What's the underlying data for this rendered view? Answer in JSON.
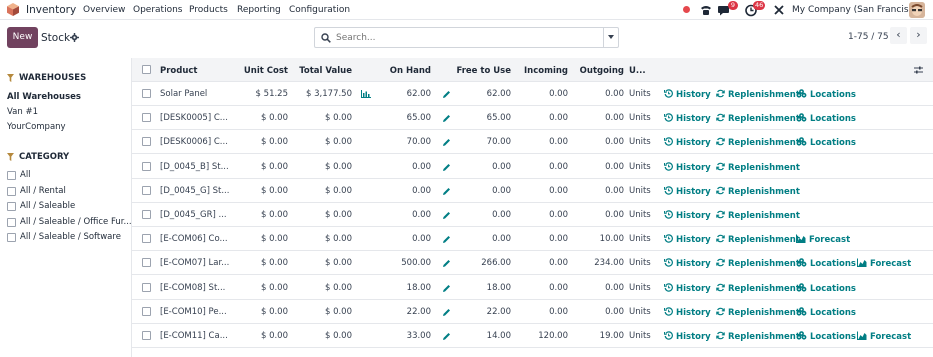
{
  "nav": {
    "app_name": "Inventory",
    "menu": [
      "Overview",
      "Operations",
      "Products",
      "Reporting",
      "Configuration"
    ],
    "activity_badge": "9",
    "clock_badge": "46",
    "company": "My Company (San Francisco)"
  },
  "control": {
    "new_label": "New",
    "breadcrumb": "Stock",
    "search_placeholder": "Search...",
    "pager": "1-75 / 75"
  },
  "sidebar": {
    "warehouses_title": "WAREHOUSES",
    "warehouses": [
      "All Warehouses",
      "Van #1",
      "YourCompany"
    ],
    "category_title": "CATEGORY",
    "categories": [
      "All",
      "All / Rental",
      "All / Saleable",
      "All / Saleable / Office Fur...",
      "All / Saleable / Software"
    ]
  },
  "table": {
    "headers": {
      "product": "Product",
      "unit_cost": "Unit Cost",
      "total_value": "Total Value",
      "on_hand": "On Hand",
      "free_to_use": "Free to Use",
      "incoming": "Incoming",
      "outgoing": "Outgoing",
      "uom": "U..."
    },
    "actions": {
      "history": "History",
      "replenishment": "Replenishment",
      "locations": "Locations",
      "forecast": "Forecast"
    },
    "rows": [
      {
        "product": "Solar Panel",
        "unit_cost": "$ 51.25",
        "total_value": "$ 3,177.50",
        "on_hand": "62.00",
        "free": "62.00",
        "incoming": "0.00",
        "outgoing": "0.00",
        "uom": "Units",
        "locations": true,
        "forecast": false,
        "forecast_short": false
      },
      {
        "product": "[DESK0005] C...",
        "unit_cost": "$ 0.00",
        "total_value": "$ 0.00",
        "on_hand": "65.00",
        "free": "65.00",
        "incoming": "0.00",
        "outgoing": "0.00",
        "uom": "Units",
        "locations": true,
        "forecast": false,
        "forecast_short": false
      },
      {
        "product": "[DESK0006] C...",
        "unit_cost": "$ 0.00",
        "total_value": "$ 0.00",
        "on_hand": "70.00",
        "free": "70.00",
        "incoming": "0.00",
        "outgoing": "0.00",
        "uom": "Units",
        "locations": true,
        "forecast": false,
        "forecast_short": false
      },
      {
        "product": "[D_0045_B] St...",
        "unit_cost": "$ 0.00",
        "total_value": "$ 0.00",
        "on_hand": "0.00",
        "free": "0.00",
        "incoming": "0.00",
        "outgoing": "0.00",
        "uom": "Units",
        "locations": false,
        "forecast": false,
        "forecast_short": false
      },
      {
        "product": "[D_0045_G] St...",
        "unit_cost": "$ 0.00",
        "total_value": "$ 0.00",
        "on_hand": "0.00",
        "free": "0.00",
        "incoming": "0.00",
        "outgoing": "0.00",
        "uom": "Units",
        "locations": false,
        "forecast": false,
        "forecast_short": false
      },
      {
        "product": "[D_0045_GR] ...",
        "unit_cost": "$ 0.00",
        "total_value": "$ 0.00",
        "on_hand": "0.00",
        "free": "0.00",
        "incoming": "0.00",
        "outgoing": "0.00",
        "uom": "Units",
        "locations": false,
        "forecast": false,
        "forecast_short": false
      },
      {
        "product": "[E-COM06] Co...",
        "unit_cost": "$ 0.00",
        "total_value": "$ 0.00",
        "on_hand": "0.00",
        "free": "0.00",
        "incoming": "0.00",
        "outgoing": "10.00",
        "uom": "Units",
        "locations": false,
        "forecast": false,
        "forecast_short": true
      },
      {
        "product": "[E-COM07] Lar...",
        "unit_cost": "$ 0.00",
        "total_value": "$ 0.00",
        "on_hand": "500.00",
        "free": "266.00",
        "incoming": "0.00",
        "outgoing": "234.00",
        "uom": "Units",
        "locations": true,
        "forecast": true,
        "forecast_short": false
      },
      {
        "product": "[E-COM08] St...",
        "unit_cost": "$ 0.00",
        "total_value": "$ 0.00",
        "on_hand": "18.00",
        "free": "18.00",
        "incoming": "0.00",
        "outgoing": "0.00",
        "uom": "Units",
        "locations": true,
        "forecast": false,
        "forecast_short": false
      },
      {
        "product": "[E-COM10] Pe...",
        "unit_cost": "$ 0.00",
        "total_value": "$ 0.00",
        "on_hand": "22.00",
        "free": "22.00",
        "incoming": "0.00",
        "outgoing": "0.00",
        "uom": "Units",
        "locations": true,
        "forecast": false,
        "forecast_short": false
      },
      {
        "product": "[E-COM11] Ca...",
        "unit_cost": "$ 0.00",
        "total_value": "$ 0.00",
        "on_hand": "33.00",
        "free": "14.00",
        "incoming": "120.00",
        "outgoing": "19.00",
        "uom": "Units",
        "locations": true,
        "forecast": true,
        "forecast_short": false
      }
    ]
  },
  "colors": {
    "brand": "#71425f",
    "action": "#017e84",
    "badge": "#dc3545"
  },
  "icons": [
    "inventory-logo-icon",
    "settings-gear-icon",
    "search-icon",
    "filter-icon",
    "history-icon",
    "replenishment-icon",
    "locations-icon",
    "forecast-icon",
    "pencil-icon",
    "chart-icon",
    "optional-columns-icon"
  ]
}
